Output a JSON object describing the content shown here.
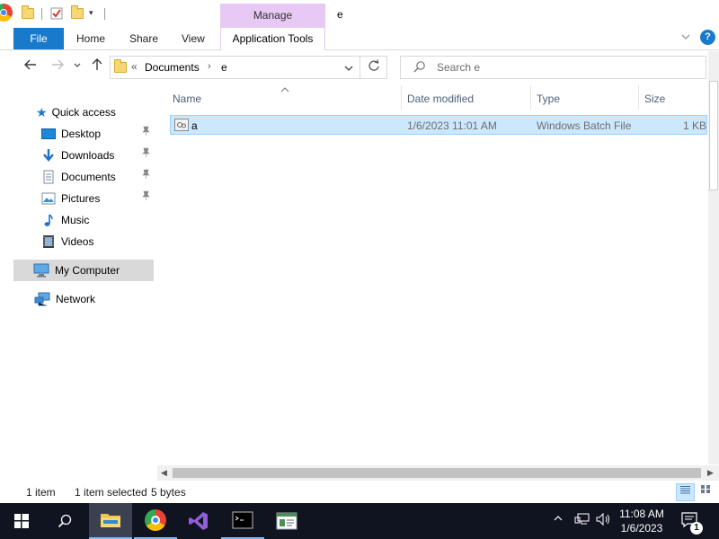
{
  "window": {
    "title": "e",
    "contextual_tab_group": "Manage"
  },
  "ribbon": {
    "tabs": [
      {
        "label": "File"
      },
      {
        "label": "Home"
      },
      {
        "label": "Share"
      },
      {
        "label": "View"
      },
      {
        "label": "Application Tools"
      }
    ]
  },
  "address": {
    "overflow": "«",
    "crumbs": [
      "Documents",
      "e"
    ]
  },
  "search": {
    "placeholder": "Search e"
  },
  "nav": {
    "quick_access": "Quick access",
    "pinned": [
      {
        "label": "Desktop",
        "icon": "desktop-icon"
      },
      {
        "label": "Downloads",
        "icon": "download-icon"
      },
      {
        "label": "Documents",
        "icon": "document-icon"
      },
      {
        "label": "Pictures",
        "icon": "picture-icon"
      }
    ],
    "unpinned": [
      {
        "label": "Music",
        "icon": "music-icon"
      },
      {
        "label": "Videos",
        "icon": "video-icon"
      }
    ],
    "my_computer": "My Computer",
    "network": "Network"
  },
  "columns": {
    "name": "Name",
    "date": "Date modified",
    "type": "Type",
    "size": "Size"
  },
  "files": [
    {
      "name": "a",
      "date": "1/6/2023 11:01 AM",
      "type": "Windows Batch File",
      "size": "1 KB"
    }
  ],
  "status": {
    "count": "1 item",
    "selection": "1 item selected",
    "size": "5 bytes"
  },
  "taskbar": {
    "time": "11:08 AM",
    "date": "1/6/2023",
    "notifications": "1"
  },
  "colors": {
    "accent": "#1979ca",
    "selection": "#cce8ff",
    "manage_tab": "#e8c8f4",
    "taskbar": "#101420"
  }
}
